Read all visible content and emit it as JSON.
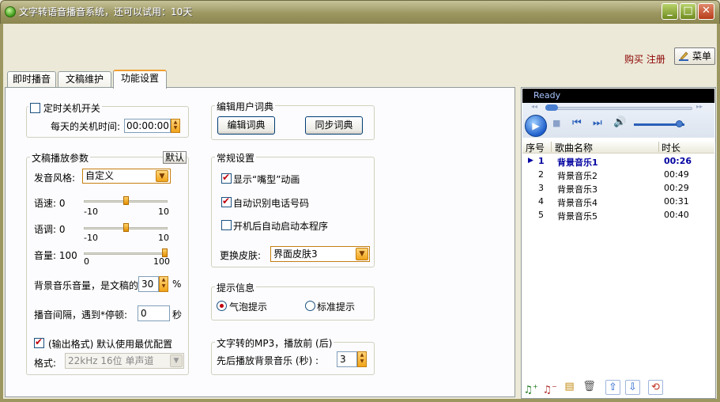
{
  "window": {
    "title": "文字转语音播音系统，还可以试用：10天",
    "buttons": [
      "_",
      "□",
      "✕"
    ]
  },
  "header": {
    "buy_register": "购买 注册",
    "menu_label": "菜单"
  },
  "tabs": [
    {
      "label": "即时播音",
      "active": false
    },
    {
      "label": "文稿维护",
      "active": false
    },
    {
      "label": "功能设置",
      "active": true
    }
  ],
  "timer": {
    "title": "定时关机开关",
    "checked": false,
    "time_label": "每天的关机时间:",
    "time_value": "00:00:00"
  },
  "playback": {
    "title": "文稿播放参数",
    "default_label": "默认",
    "voice_style_label": "发音风格:",
    "voice_style_value": "自定义",
    "speed_label": "语速: 0",
    "speed_min": "-10",
    "speed_max": "10",
    "speed_value": 0,
    "pitch_label": "语调: 0",
    "pitch_min": "-10",
    "pitch_max": "10",
    "pitch_value": 0,
    "volume_label": "音量: 100",
    "volume_min": "0",
    "volume_max": "100",
    "volume_value": 100,
    "bgm_volume_label": "背景音乐音量，是文稿的",
    "bgm_volume_value": "30",
    "bgm_volume_unit": "%",
    "interval_label": "播音间隔，遇到*停顿:",
    "interval_value": "0",
    "interval_unit": "秒",
    "output_best_label": "(输出格式) 默认使用最优配置",
    "output_best_checked": true,
    "format_label": "格式:",
    "format_value": "22kHz 16位 单声道"
  },
  "dictionary": {
    "title": "编辑用户词典",
    "edit_button": "编辑词典",
    "sync_button": "同步词典"
  },
  "general": {
    "title": "常规设置",
    "show_mouth_label": "显示“嘴型”动画",
    "show_mouth_checked": true,
    "auto_phone_label": "自动识别电话号码",
    "auto_phone_checked": true,
    "autostart_label": "开机后自动启动本程序",
    "autostart_checked": false,
    "skin_label": "更换皮肤:",
    "skin_value": "界面皮肤3"
  },
  "hint": {
    "title": "提示信息",
    "bubble_label": "气泡提示",
    "standard_label": "标准提示",
    "selected": "bubble"
  },
  "mp3": {
    "title": "文字转的MP3，播放前 (后)",
    "bgm_seconds_label": "先后播放背景音乐 (秒) :",
    "bgm_seconds_value": "3"
  },
  "player": {
    "status": "Ready",
    "volume": 0.9
  },
  "playlist": {
    "columns": [
      "序号",
      "歌曲名称",
      "时长"
    ],
    "rows": [
      {
        "index": "1",
        "name": "背景音乐1",
        "duration": "00:26",
        "current": true
      },
      {
        "index": "2",
        "name": "背景音乐2",
        "duration": "00:49",
        "current": false
      },
      {
        "index": "3",
        "name": "背景音乐3",
        "duration": "00:29",
        "current": false
      },
      {
        "index": "4",
        "name": "背景音乐4",
        "duration": "00:31",
        "current": false
      },
      {
        "index": "5",
        "name": "背景音乐5",
        "duration": "00:40",
        "current": false
      }
    ]
  },
  "toolbar_icons": [
    "add-icon",
    "remove-icon",
    "add-folder-icon",
    "trash-icon",
    "move-up-icon",
    "move-down-icon",
    "loop-icon"
  ]
}
